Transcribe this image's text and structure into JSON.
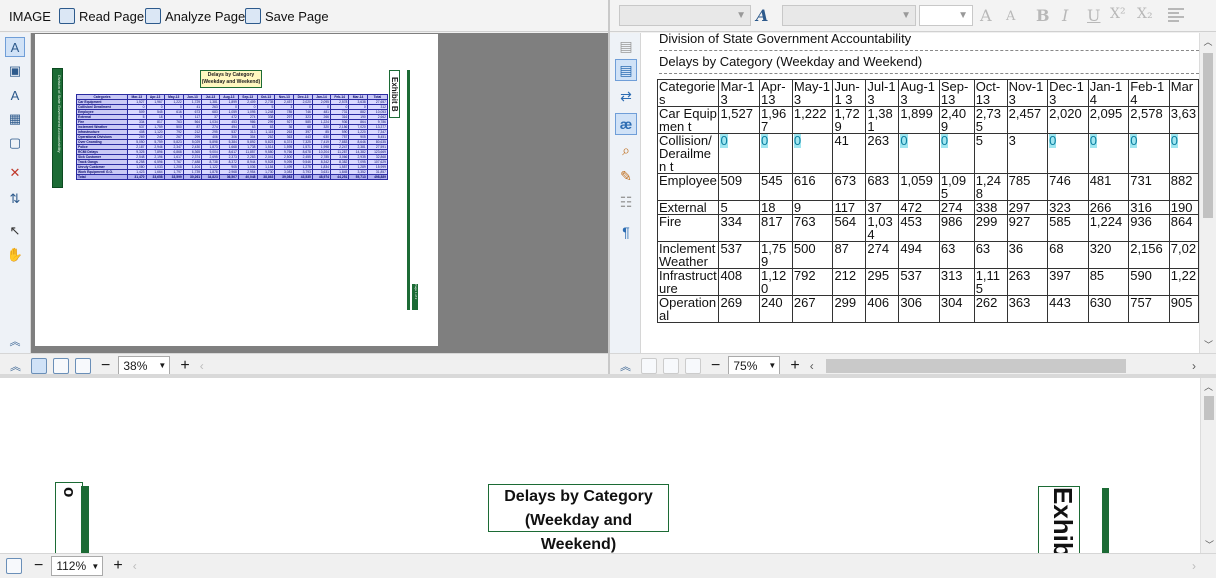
{
  "toolbar": {
    "image_label": "IMAGE",
    "read_page": "Read Page",
    "analyze_page": "Analyze Page",
    "save_page": "Save Page"
  },
  "format_bar": {
    "font_color_glyph": "A",
    "grow_glyph": "A",
    "shrink_glyph": "A",
    "bold": "B",
    "italic": "I",
    "underline": "U",
    "superscript": "X²",
    "subscript": "X₂"
  },
  "image_zoom": {
    "value": "38%"
  },
  "text_zoom": {
    "value": "75%"
  },
  "bottom_zoom": {
    "value": "112%"
  },
  "mini_page": {
    "title_line1": "Delays by Category",
    "title_line2": "(Weekday and Weekend)",
    "side_left": "Division of State Government Accountability",
    "side_right": "Exhibit B",
    "side_right_small": "Page 1 of 2",
    "headers": [
      "Categories",
      "Mar-13",
      "Apr-13",
      "May-13",
      "Jun-13",
      "Jul-13",
      "Aug-13",
      "Sep-13",
      "Oct-13",
      "Nov-13",
      "Dec-13",
      "Jan-14",
      "Feb-14",
      "Mar-14",
      "Total"
    ],
    "rows": [
      [
        "Car Equipment",
        "1,527",
        "1,967",
        "1,222",
        "1,729",
        "1,381",
        "1,899",
        "2,409",
        "2,735",
        "2,457",
        "2,020",
        "2,095",
        "2,578",
        "3,638",
        "27,657"
      ],
      [
        "Collision/ Derailment",
        "0",
        "0",
        "0",
        "41",
        "263",
        "0",
        "0",
        "5",
        "3",
        "0",
        "0",
        "0",
        "0",
        "312"
      ],
      [
        "Employee",
        "509",
        "545",
        "616",
        "673",
        "683",
        "1,059",
        "1,095",
        "1,248",
        "785",
        "746",
        "481",
        "731",
        "882",
        "10,053"
      ],
      [
        "External",
        "5",
        "18",
        "9",
        "117",
        "37",
        "472",
        "274",
        "338",
        "297",
        "323",
        "266",
        "316",
        "190",
        "2,662"
      ],
      [
        "Fire",
        "334",
        "817",
        "763",
        "564",
        "1,034",
        "453",
        "986",
        "299",
        "927",
        "585",
        "1,224",
        "936",
        "864",
        "9,786"
      ],
      [
        "Inclement Weather",
        "537",
        "1,759",
        "500",
        "87",
        "274",
        "494",
        "63",
        "63",
        "36",
        "68",
        "320",
        "2,156",
        "7,020",
        "13,377"
      ],
      [
        "Infrastructure",
        "408",
        "1,120",
        "792",
        "212",
        "295",
        "537",
        "313",
        "1,115",
        "263",
        "397",
        "85",
        "590",
        "1,220",
        "7,347"
      ],
      [
        "Operational Divisions",
        "269",
        "240",
        "267",
        "299",
        "406",
        "306",
        "304",
        "262",
        "363",
        "443",
        "630",
        "757",
        "905",
        "5,451"
      ],
      [
        "Over Crowding",
        "5,050",
        "5,759",
        "5,823",
        "5,029",
        "5,898",
        "5,384",
        "5,892",
        "5,823",
        "6,374",
        "7,325",
        "7,419",
        "7,883",
        "8,646",
        "80,635"
      ],
      [
        "Police",
        "2,187",
        "2,946",
        "2,347",
        "2,430",
        "1,873",
        "1,668",
        "1,738",
        "1,514",
        "1,595",
        "1,571",
        "1,998",
        "2,247",
        "2,381",
        "27,591"
      ],
      [
        "RCMI Delays",
        "9,325",
        "7,896",
        "6,868",
        "6,365",
        "9,004",
        "8,617",
        "11,857",
        "9,580",
        "9,766",
        "8,678",
        "10,204",
        "11,287",
        "14,382",
        "123,669"
      ],
      [
        "Sick Customer",
        "2,548",
        "2,196",
        "1,617",
        "2,374",
        "2,695",
        "2,373",
        "2,283",
        "2,041",
        "2,500",
        "2,455",
        "2,785",
        "3,066",
        "2,935",
        "32,868"
      ],
      [
        "Track Gangs",
        "6,258",
        "6,596",
        "7,767",
        "7,488",
        "8,738",
        "8,372",
        "8,944",
        "9,528",
        "9,095",
        "9,546",
        "8,342",
        "8,382",
        "7,095",
        "107,629"
      ],
      [
        "Unruly Customer",
        "1,080",
        "1,033",
        "1,208",
        "1,104",
        "1,122",
        "905",
        "1,036",
        "1,184",
        "1,499",
        "1,275",
        "1,834",
        "1,557",
        "1,289",
        "15,999"
      ],
      [
        "Work Equipment/ G.O.",
        "1,423",
        "1,664",
        "1,797",
        "1,739",
        "1,878",
        "2,968",
        "2,954",
        "1,730",
        "3,083",
        "3,793",
        "3,631",
        "1,845",
        "3,352",
        "31,857"
      ],
      [
        "Total",
        "31,470",
        "33,658",
        "33,599",
        "30,261",
        "34,823",
        "36,507",
        "40,048",
        "38,863",
        "39,083",
        "43,535",
        "48,974",
        "44,251",
        "55,713",
        "498,889"
      ]
    ]
  },
  "text_pane": {
    "line1": "Division of State Government Accountability",
    "line2": "Delays by Category (Weekday and Weekend)",
    "headers": [
      "Categorie s",
      "Mar-13",
      "Apr- 13",
      "May-1 3",
      "Jun-1 3",
      "Jul-1 3",
      "Aug-1 3",
      "Sep- 13",
      "Oct- 13",
      "Nov-1 3",
      "Dec-1 3",
      "Jan-14",
      "Feb-14",
      "Mar"
    ],
    "rows": [
      [
        "Car Equipmen t",
        "1,527",
        "1,96 7",
        "1,222",
        "1,72 9",
        "1,38 1",
        "1,899",
        "2,40 9",
        "2,73 5",
        "2,457",
        "2,020",
        "2,095",
        "2,578",
        "3,63"
      ],
      [
        "Collision/ Derailmen t",
        "0",
        "0",
        "0",
        "41",
        "263",
        "0",
        "0",
        "5",
        "3",
        "0",
        "0",
        "0",
        "0"
      ],
      [
        "Employee",
        "509",
        "545",
        "616",
        "673",
        "683",
        "1,059",
        "1,09 5",
        "1,24 8",
        "785",
        "746",
        "481",
        "731",
        "882"
      ],
      [
        "External",
        "5",
        "18",
        "9",
        "117",
        "37",
        "472",
        "274",
        "338",
        "297",
        "323",
        "266",
        "316",
        "190"
      ],
      [
        "Fire",
        "334",
        "817",
        "763",
        "564",
        "1,03 4",
        "453",
        "986",
        "299",
        "927",
        "585",
        "1,224",
        "936",
        "864"
      ],
      [
        "Inclement Weather",
        "537",
        "1,75 9",
        "500",
        "87",
        "274",
        "494",
        "63",
        "63",
        "36",
        "68",
        "320",
        "2,156",
        "7,02"
      ],
      [
        "Infrastruct ure",
        "408",
        "1,12 0",
        "792",
        "212",
        "295",
        "537",
        "313",
        "1,11 5",
        "263",
        "397",
        "85",
        "590",
        "1,22"
      ],
      [
        "Operation al",
        "269",
        "240",
        "267",
        "299",
        "406",
        "306",
        "304",
        "262",
        "363",
        "443",
        "630",
        "757",
        "905"
      ]
    ]
  },
  "bottom_page": {
    "title_line1": "Delays by Category",
    "title_line2": "(Weekday and Weekend)",
    "side_left": "Division o",
    "side_right": "Exhib"
  }
}
